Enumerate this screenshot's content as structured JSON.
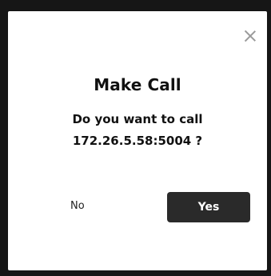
{
  "dialog": {
    "title": "Make Call",
    "message_line1": "Do you want to call",
    "message_line2": "172.26.5.58:5004 ?",
    "no_label": "No",
    "yes_label": "Yes"
  },
  "icons": {
    "close": "close-icon"
  }
}
